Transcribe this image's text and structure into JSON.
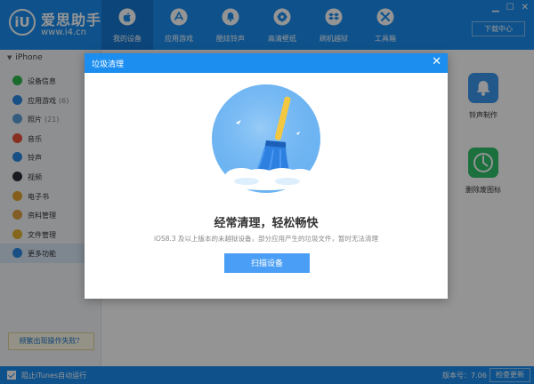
{
  "app": {
    "logo_text": "iU",
    "name": "爱思助手",
    "url": "www.i4.cn",
    "window_controls": [
      "▁",
      "☐",
      "✕"
    ],
    "download_center": "下载中心",
    "colors": {
      "brand": "#1b8ef0",
      "active_nav": "#1578d1"
    }
  },
  "nav": {
    "items": [
      {
        "label": "我的设备",
        "icon": "apple-icon",
        "active": true
      },
      {
        "label": "应用游戏",
        "icon": "app-store-icon",
        "active": false
      },
      {
        "label": "酷炫铃声",
        "icon": "bell-icon",
        "active": false
      },
      {
        "label": "高清壁纸",
        "icon": "flower-icon",
        "active": false
      },
      {
        "label": "刷机越狱",
        "icon": "dropbox-icon",
        "active": false
      },
      {
        "label": "工具箱",
        "icon": "tools-icon",
        "active": false
      }
    ]
  },
  "sidebar": {
    "device_name": "iPhone",
    "items": [
      {
        "label": "设备信息",
        "count": "",
        "icon": "info-icon",
        "color": "#2db84d"
      },
      {
        "label": "应用游戏",
        "count": "(6)",
        "icon": "app-icon",
        "color": "#2a8ae6"
      },
      {
        "label": "照片",
        "count": "(21)",
        "icon": "photo-icon",
        "color": "#5aa0d8"
      },
      {
        "label": "音乐",
        "count": "",
        "icon": "music-icon",
        "color": "#e8513a"
      },
      {
        "label": "铃声",
        "count": "",
        "icon": "bell-icon",
        "color": "#2a8ae6"
      },
      {
        "label": "视频",
        "count": "",
        "icon": "video-icon",
        "color": "#2d2d3a"
      },
      {
        "label": "电子书",
        "count": "",
        "icon": "book-icon",
        "color": "#e5a330"
      },
      {
        "label": "资料管理",
        "count": "",
        "icon": "contacts-icon",
        "color": "#e0a040"
      },
      {
        "label": "文件管理",
        "count": "",
        "icon": "folder-icon",
        "color": "#e3b22f"
      },
      {
        "label": "更多功能",
        "count": "",
        "icon": "grid-icon",
        "color": "#2a8ae6",
        "active": true
      }
    ],
    "help_button": "频繁出现操作失败？"
  },
  "main": {
    "tools": [
      {
        "label": "铃声制作",
        "icon": "bell-icon",
        "color": "#3a97ec"
      },
      {
        "label": "删除废图标",
        "icon": "clock-circle-icon",
        "color": "#2fc16a"
      }
    ]
  },
  "statusbar": {
    "itunes_autorun": "阻止iTunes自动运行",
    "version": "版本号：7.06",
    "check_update": "检查更新"
  },
  "dialog": {
    "title": "垃圾清理",
    "close": "✕",
    "heading": "经常清理，轻松畅快",
    "description": "iOS8.3 及以上版本的未越狱设备，部分应用产生的垃圾文件，暂时无法清理",
    "scan_button": "扫描设备"
  }
}
